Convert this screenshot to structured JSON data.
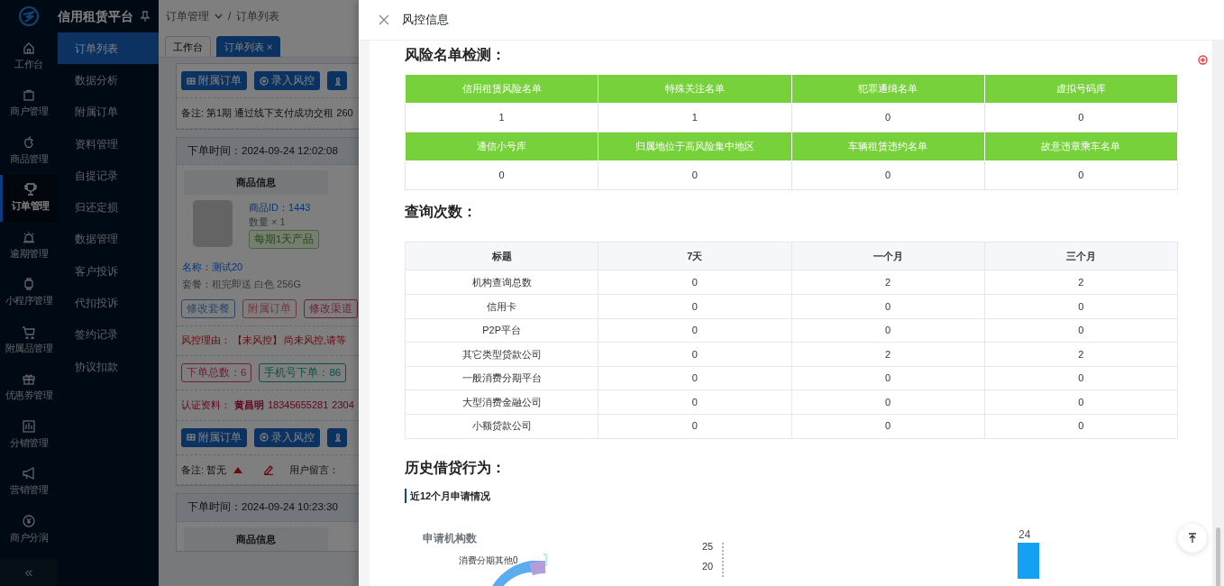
{
  "sidebar": {
    "title": "信用租赁平台",
    "items": [
      {
        "label": "工作台",
        "selected": false
      },
      {
        "label": "商户管理",
        "selected": false
      },
      {
        "label": "商品管理",
        "selected": false
      },
      {
        "label": "订单管理",
        "selected": true
      },
      {
        "label": "逾期管理",
        "selected": false
      },
      {
        "label": "小程序管理",
        "selected": false
      },
      {
        "label": "附属品管理",
        "selected": false
      },
      {
        "label": "优惠券管理",
        "selected": false
      },
      {
        "label": "分销管理",
        "selected": false
      },
      {
        "label": "营销管理",
        "selected": false
      },
      {
        "label": "商户分润",
        "selected": false
      }
    ],
    "collapse": "«"
  },
  "submenu": [
    {
      "label": "订单列表",
      "selected": true
    },
    {
      "label": "数据分析",
      "selected": false
    },
    {
      "label": "附属订单",
      "selected": false
    },
    {
      "label": "资料管理",
      "selected": false
    },
    {
      "label": "自提记录",
      "selected": false
    },
    {
      "label": "归还定损",
      "selected": false
    },
    {
      "label": "数据管理",
      "selected": false
    },
    {
      "label": "客户投诉",
      "selected": false
    },
    {
      "label": "代扣投诉",
      "selected": false
    },
    {
      "label": "签约记录",
      "selected": false
    },
    {
      "label": "协议扣款",
      "selected": false
    }
  ],
  "breadcrumb": {
    "items": [
      "订单管理",
      "订单列表"
    ],
    "separator": "/"
  },
  "tabs": [
    {
      "label": "工作台",
      "selected": false
    },
    {
      "label": "订单列表",
      "selected": true,
      "close": "×"
    }
  ],
  "orders": [
    {
      "buttons": [
        "附属订单",
        "录入风控"
      ],
      "note": "备注: 第1期 通过线下支付成功交租 260"
    },
    {
      "time": "下单时间：2024-09-24 12:02:08",
      "goods_header": "商品信息",
      "product_id": "商品ID：1443",
      "quantity": "数量 × 1",
      "tag": "每期1天产品",
      "name": "名称：测试20",
      "package": "套餐：租完即送 白色 256G",
      "actions": [
        {
          "label": "修改套餐",
          "kind": "blue"
        },
        {
          "label": "附属订单",
          "kind": "red"
        },
        {
          "label": "修改渠道",
          "kind": "pink"
        }
      ],
      "risk_label": "风控理由：",
      "risk_status": "【未风控】",
      "risk_text": "尚未风控,请等",
      "stats": [
        {
          "text": "下单总数：6",
          "kind": "pink"
        },
        {
          "text": "手机号下单：86",
          "kind": "teal"
        }
      ],
      "auth_label": "认证资料：",
      "auth_name": "黄昌明",
      "auth_phone": "18345655281",
      "auth_id": "2304",
      "buttons": [
        "附属订单",
        "录入风控"
      ],
      "note": "备注: 暂无",
      "message": "用户留言："
    },
    {
      "time": "下单时间：2024-09-24 10:23:30",
      "goods_header": "商品信息"
    }
  ],
  "drawer": {
    "title": "风控信息",
    "risk_list": {
      "title": "风险名单检测：",
      "groups": [
        {
          "headers": [
            "信用租赁风险名单",
            "特殊关注名单",
            "犯罪通缉名单",
            "虚拟号码库"
          ],
          "values": [
            "1",
            "1",
            "0",
            "0"
          ]
        },
        {
          "headers": [
            "通信小号库",
            "归属地位于高风险集中地区",
            "车辆租赁违约名单",
            "故意违章乘车名单"
          ],
          "values": [
            "0",
            "0",
            "0",
            "0"
          ]
        }
      ]
    },
    "query_counts": {
      "title": "查询次数：",
      "columns": [
        "标题",
        "7天",
        "一个月",
        "三个月"
      ],
      "rows": [
        [
          "机构查询总数",
          "0",
          "2",
          "2"
        ],
        [
          "信用卡",
          "0",
          "0",
          "0"
        ],
        [
          "P2P平台",
          "0",
          "0",
          "0"
        ],
        [
          "其它类型贷款公司",
          "0",
          "2",
          "2"
        ],
        [
          "一般消费分期平台",
          "0",
          "0",
          "0"
        ],
        [
          "大型消费金融公司",
          "0",
          "0",
          "0"
        ],
        [
          "小额贷款公司",
          "0",
          "0",
          "0"
        ]
      ]
    },
    "history": {
      "title": "历史借贷行为：",
      "subtitle": "近12个月申请情况",
      "donut_title": "申请机构数",
      "donut_label": "消费分期其他0",
      "bar_y_labels": [
        "25",
        "20"
      ],
      "bar_label": "24"
    }
  }
}
